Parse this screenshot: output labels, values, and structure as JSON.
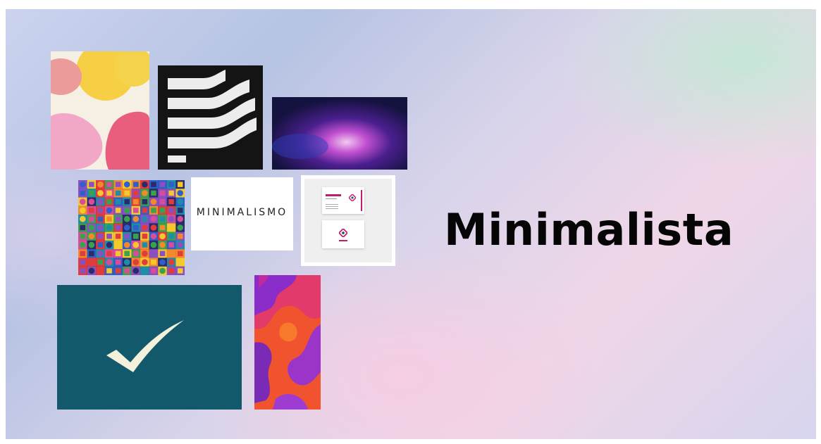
{
  "slide": {
    "title": "Minimalista",
    "accent_colors": [
      "#12596b",
      "#c21d6b",
      "#f4d24c"
    ]
  },
  "tiles": {
    "organic_blobs": {
      "icon": "organic-blobs-image"
    },
    "stripes_logo": {
      "icon": "curved-stripes-image"
    },
    "purple_glow": {
      "icon": "purple-glow-image"
    },
    "geometric_grid": {
      "icon": "geometric-grid-image"
    },
    "minimalismo_text": {
      "text": "MINIMALISMO"
    },
    "business_cards": {
      "icon": "business-card-mockup-image"
    },
    "checkmark": {
      "icon": "checkmark-icon",
      "background": "#12596b"
    },
    "papercut_waves": {
      "icon": "papercut-waves-image"
    }
  }
}
